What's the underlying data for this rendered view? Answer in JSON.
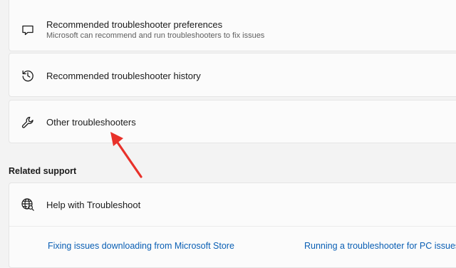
{
  "cards": {
    "preferences": {
      "title": "Recommended troubleshooter preferences",
      "subtitle": "Microsoft can recommend and run troubleshooters to fix issues",
      "icon": "chat-bubble-icon"
    },
    "history": {
      "title": "Recommended troubleshooter history",
      "icon": "history-icon"
    },
    "other": {
      "title": "Other troubleshooters",
      "icon": "wrench-icon"
    }
  },
  "related_support": {
    "header": "Related support",
    "help": {
      "title": "Help with Troubleshoot",
      "icon": "globe-search-icon",
      "links": [
        "Fixing issues downloading from Microsoft Store",
        "Running a troubleshooter for PC issues"
      ]
    }
  },
  "annotation": {
    "arrow_color": "#e8312a"
  }
}
